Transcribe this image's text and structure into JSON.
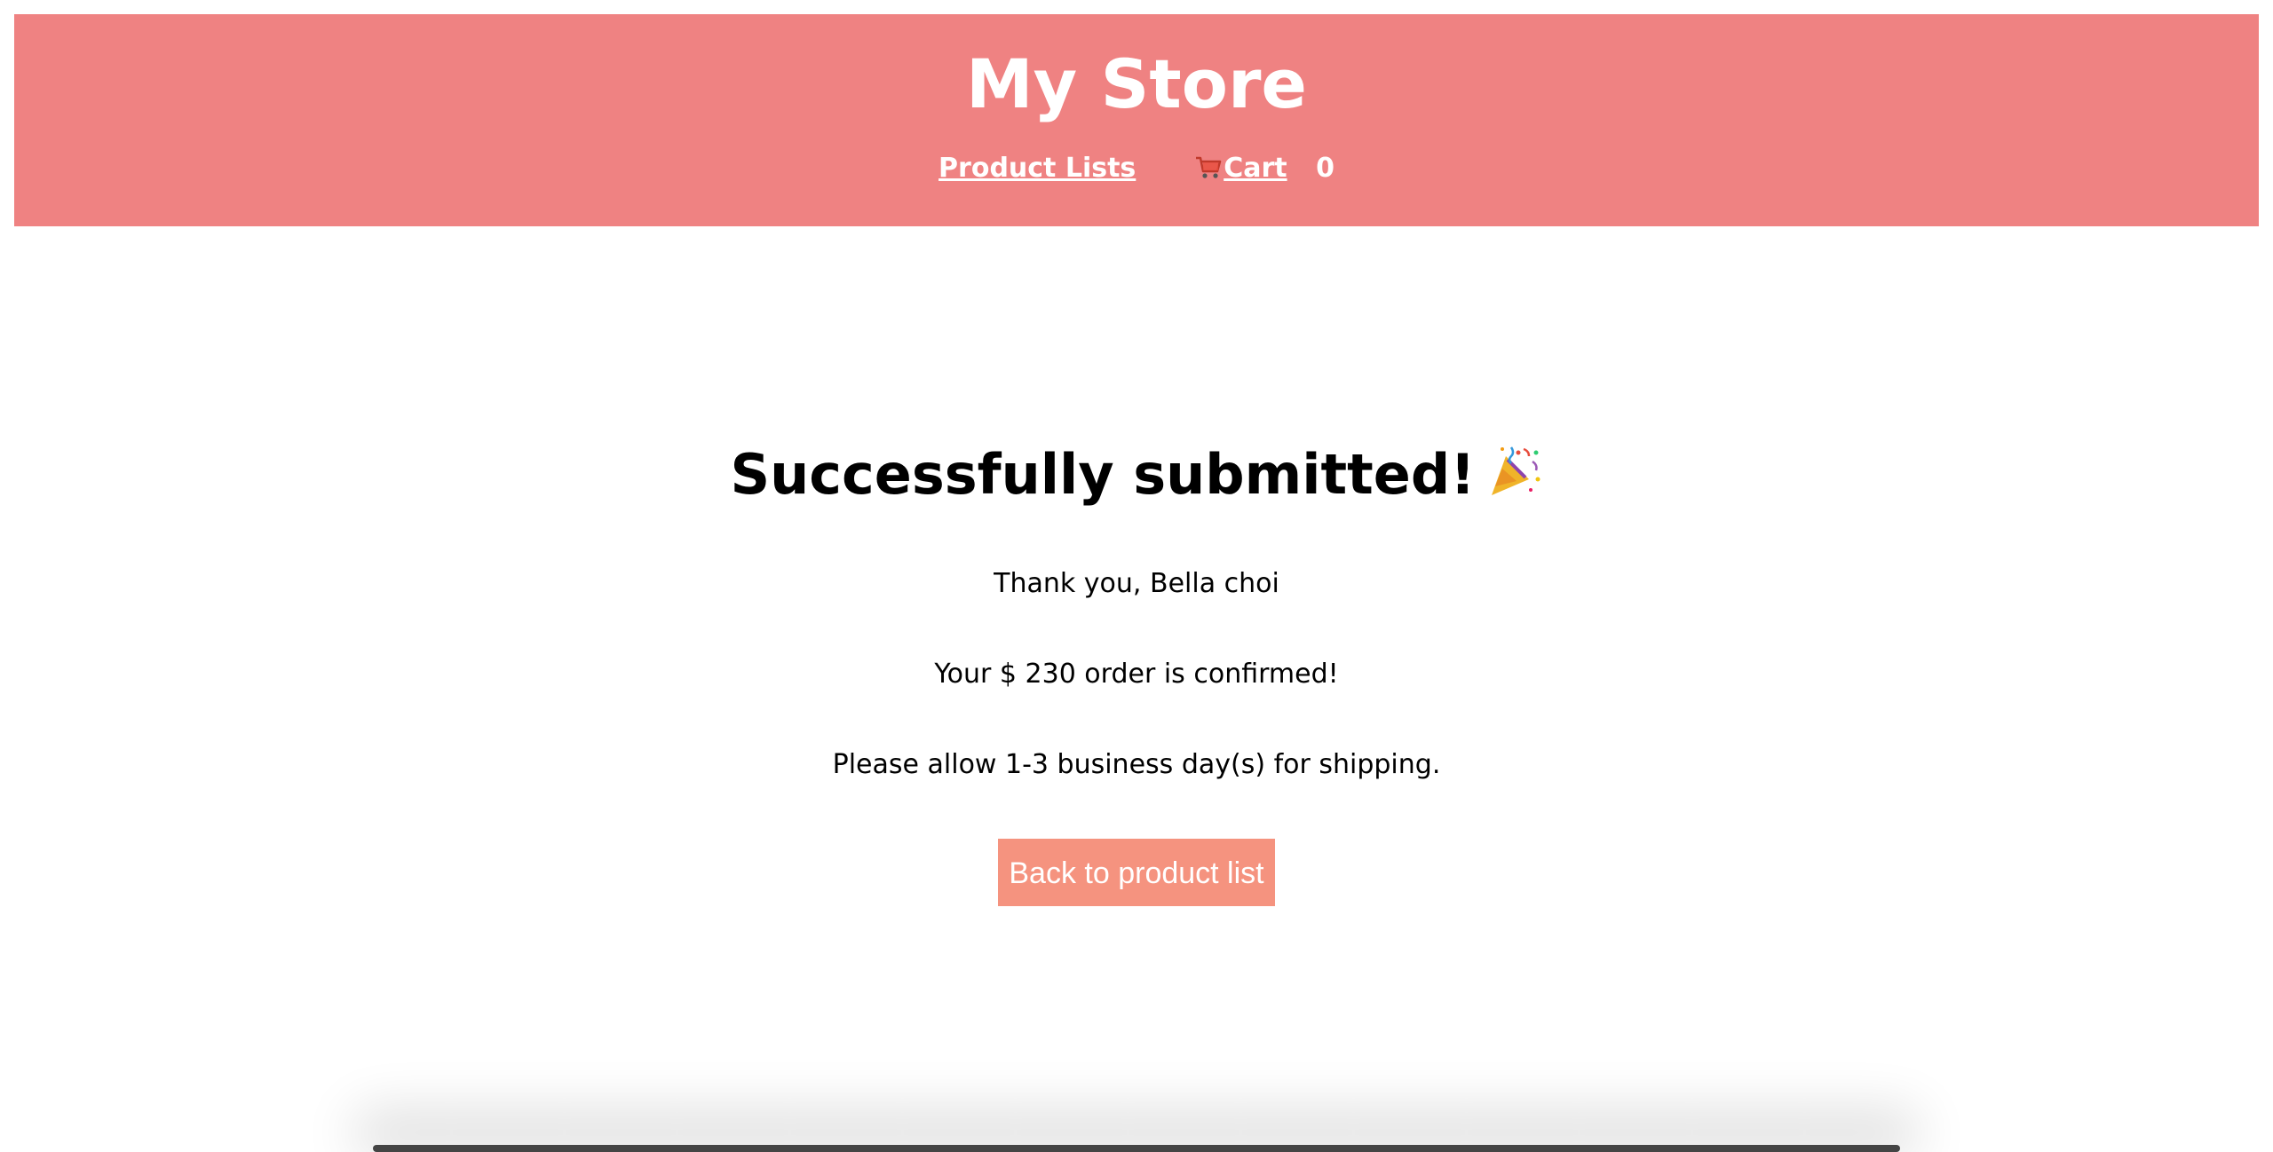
{
  "header": {
    "title": "My Store",
    "background_color": "#ef8282",
    "nav": {
      "product_lists_label": "Product Lists",
      "cart_label": "Cart",
      "cart_icon": "shopping-cart-icon",
      "cart_count": "0"
    }
  },
  "confirmation": {
    "title": "Successfully submitted!",
    "title_icon": "party-popper-icon",
    "thank_you": "Thank you, Bella choi",
    "order_message": "Your $ 230 order is confirmed!",
    "shipping_message": "Please allow 1-3 business day(s) for shipping.",
    "back_button_label": "Back to product list",
    "button_color": "#f5937f"
  }
}
